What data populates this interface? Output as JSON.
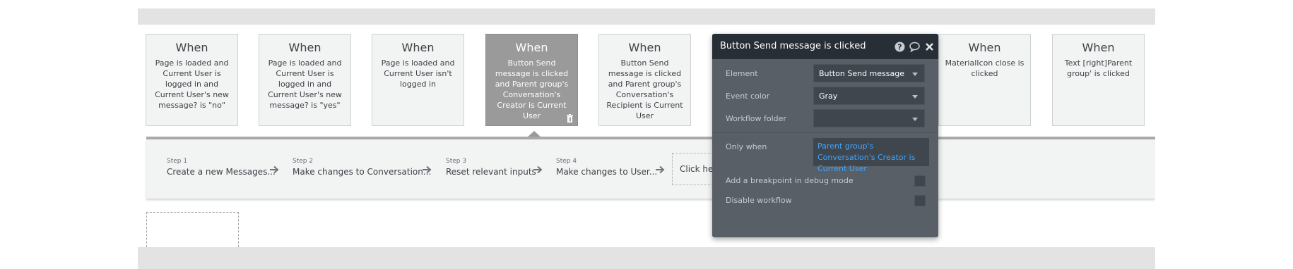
{
  "events": [
    {
      "when": "When",
      "description": "Page is loaded and Current User is logged in and Current User's new message? is \"no\""
    },
    {
      "when": "When",
      "description": "Page is loaded and Current User is logged in and Current User's new message? is \"yes\""
    },
    {
      "when": "When",
      "description": "Page is loaded and Current User isn't logged in"
    },
    {
      "when": "When",
      "description": "Button Send message is clicked and Parent group's Conversation's Creator is Current User",
      "selected": true
    },
    {
      "when": "When",
      "description": "Button Send message is clicked and Parent group's Conversation's Recipient is Current User"
    },
    {
      "when": "When",
      "description": "MaterialIcon close is clicked"
    },
    {
      "when": "When",
      "description": "Text [right]Parent group' is clicked"
    }
  ],
  "steps": [
    {
      "number": "Step 1",
      "label": "Create a new Messages..."
    },
    {
      "number": "Step 2",
      "label": "Make changes to Conversation..."
    },
    {
      "number": "Step 3",
      "label": "Reset relevant inputs"
    },
    {
      "number": "Step 4",
      "label": "Make changes to User..."
    }
  ],
  "add_step_label": "Click here to add an action...",
  "panel": {
    "title": "Button Send message is clicked",
    "icons": [
      "help-icon",
      "comment-icon",
      "close-icon"
    ],
    "element_label": "Element",
    "element_value": "Button Send message",
    "event_color_label": "Event color",
    "event_color_value": "Gray",
    "workflow_folder_label": "Workflow folder",
    "workflow_folder_value": "",
    "only_when_label": "Only when",
    "only_when_value": "Parent group's Conversation's Creator is Current User",
    "breakpoint_label": "Add a breakpoint in debug mode",
    "disable_label": "Disable workflow"
  },
  "colors": {
    "selected_card": "#9a9a9a",
    "panel_bg": "#595f66",
    "panel_header": "#272e35",
    "condition_text": "#3fa5ff"
  }
}
